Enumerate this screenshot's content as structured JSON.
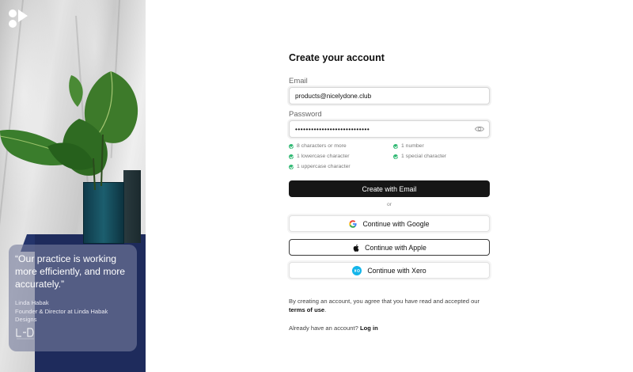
{
  "testimonial": {
    "quote": "“Our practice is working more efficiently, and more accurately.”",
    "author": "Linda Habak",
    "role": "Founder & Director at Linda Habak Designs"
  },
  "form": {
    "title": "Create your account",
    "email_label": "Email",
    "email_value": "products@nicelydone.club",
    "password_label": "Password",
    "password_value": "••••••••••••••••••••••••••••",
    "rules": [
      "8 characters or more",
      "1 number",
      "1 lowercase character",
      "1 special character",
      "1 uppercase character"
    ],
    "primary_button": "Create with Email",
    "or_text": "or",
    "google_button": "Continue with Google",
    "apple_button": "Continue with Apple",
    "xero_button": "Continue with Xero",
    "terms_prefix": "By creating an account, you agree that you have read and accepted our",
    "terms_link": "terms of use",
    "terms_suffix": ".",
    "login_prefix": "Already have an account?",
    "login_link": "Log in"
  },
  "icons": {
    "logo": "brand-logo-icon",
    "eye": "eye-icon",
    "check": "check-circle-icon",
    "google": "google-icon",
    "apple": "apple-icon",
    "xero": "xero-icon"
  },
  "colors": {
    "primary_button": "#161616",
    "check": "#2eb872",
    "cabinet": "#1e2b5c",
    "xero": "#13b5ea"
  }
}
